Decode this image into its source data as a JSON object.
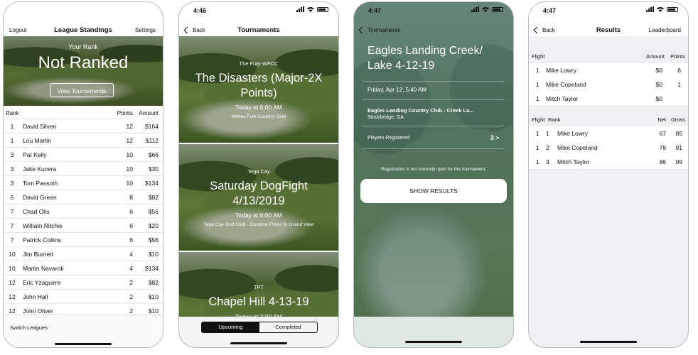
{
  "standings": {
    "nav": {
      "left": "Logout",
      "title": "League Standings",
      "right": "Settings"
    },
    "hero": {
      "label": "Your Rank",
      "value": "Not Ranked",
      "button": "View Tournaments"
    },
    "columns": {
      "rank": "Rank",
      "points": "Points",
      "amount": "Amount"
    },
    "rows": [
      {
        "rank": "1",
        "name": "David Silveri",
        "points": "12",
        "amount": "$164"
      },
      {
        "rank": "1",
        "name": "Lou  Martin",
        "points": "12",
        "amount": "$112"
      },
      {
        "rank": "3",
        "name": "Pat Kelly",
        "points": "10",
        "amount": "$66"
      },
      {
        "rank": "3",
        "name": "Jake Kucera",
        "points": "10",
        "amount": "$30"
      },
      {
        "rank": "3",
        "name": "Tom Passoth",
        "points": "10",
        "amount": "$134"
      },
      {
        "rank": "6",
        "name": "David Green",
        "points": "8",
        "amount": "$82"
      },
      {
        "rank": "7",
        "name": "Chad Olis",
        "points": "6",
        "amount": "$56"
      },
      {
        "rank": "7",
        "name": "William Ritchie",
        "points": "6",
        "amount": "$20"
      },
      {
        "rank": "7",
        "name": "Patrick Collins",
        "points": "6",
        "amount": "$56"
      },
      {
        "rank": "10",
        "name": "Jim Burnett",
        "points": "4",
        "amount": "$10"
      },
      {
        "rank": "10",
        "name": "Martin Navaroli",
        "points": "4",
        "amount": "$134"
      },
      {
        "rank": "12",
        "name": "Eric Yzaguirre",
        "points": "2",
        "amount": "$82"
      },
      {
        "rank": "12",
        "name": "John Hall",
        "points": "2",
        "amount": "$10"
      },
      {
        "rank": "12",
        "name": "John Oliver",
        "points": "2",
        "amount": "$10"
      }
    ],
    "footer": "Switch Leagues"
  },
  "tournaments": {
    "status_time": "4:46",
    "nav": {
      "back": "Back",
      "title": "Tournaments"
    },
    "cards": [
      {
        "org": "The Fray-WFCC",
        "name": "The Disasters (Major-2X Points)",
        "when": "Today at 6:00 AM",
        "club": "Willow Fork Country Club"
      },
      {
        "org": "Tega Cay",
        "name": "Saturday DogFight 4/13/2019",
        "when": "Today at 6:00 AM",
        "club": "Tega Cay Golf Club - Carolina Pines To Grand View"
      },
      {
        "org": "TPT",
        "name": "Chapel Hill 4-13-19",
        "when": "Today at 7:30 AM",
        "club": ""
      }
    ],
    "segments": [
      "Upcoming",
      "Completed"
    ],
    "selected_segment": "Upcoming"
  },
  "detail": {
    "status_time": "4:47",
    "nav": {
      "back": "Tournaments"
    },
    "title": "Eagles Landing Creek/ Lake 4-12-19",
    "datetime": "Friday, Apr 12, 5:40 AM",
    "club": "Eagles Landing Country Club - Creek La...",
    "location": "Stockbridge, GA",
    "players_label": "Players Registered",
    "players_count": "3",
    "registration_note": "Registration is not currently open for this tournament.",
    "show_results": "SHOW RESULTS"
  },
  "results": {
    "status_time": "4:47",
    "nav": {
      "back": "Back",
      "title": "Results",
      "right": "Leaderboard"
    },
    "flight_columns": {
      "flight": "Flight",
      "amount": "Amount",
      "points": "Points"
    },
    "flight_rows": [
      {
        "flight": "1",
        "name": "Mike Lowry",
        "amount": "$0",
        "points": "6"
      },
      {
        "flight": "1",
        "name": "Mike Copeland",
        "amount": "$0",
        "points": "1"
      },
      {
        "flight": "1",
        "name": "Mitch Taylor",
        "amount": "$0",
        "points": ""
      }
    ],
    "rank_columns": {
      "flight": "Flight",
      "rank": "Rank",
      "net": "Net",
      "gross": "Gross"
    },
    "rank_rows": [
      {
        "flight": "1",
        "rank": "1",
        "name": "Mike Lowry",
        "net": "67",
        "gross": "85"
      },
      {
        "flight": "1",
        "rank": "2",
        "name": "Mike Copeland",
        "net": "78",
        "gross": "91"
      },
      {
        "flight": "1",
        "rank": "3",
        "name": "Mitch Taylor",
        "net": "86",
        "gross": "99"
      }
    ]
  }
}
